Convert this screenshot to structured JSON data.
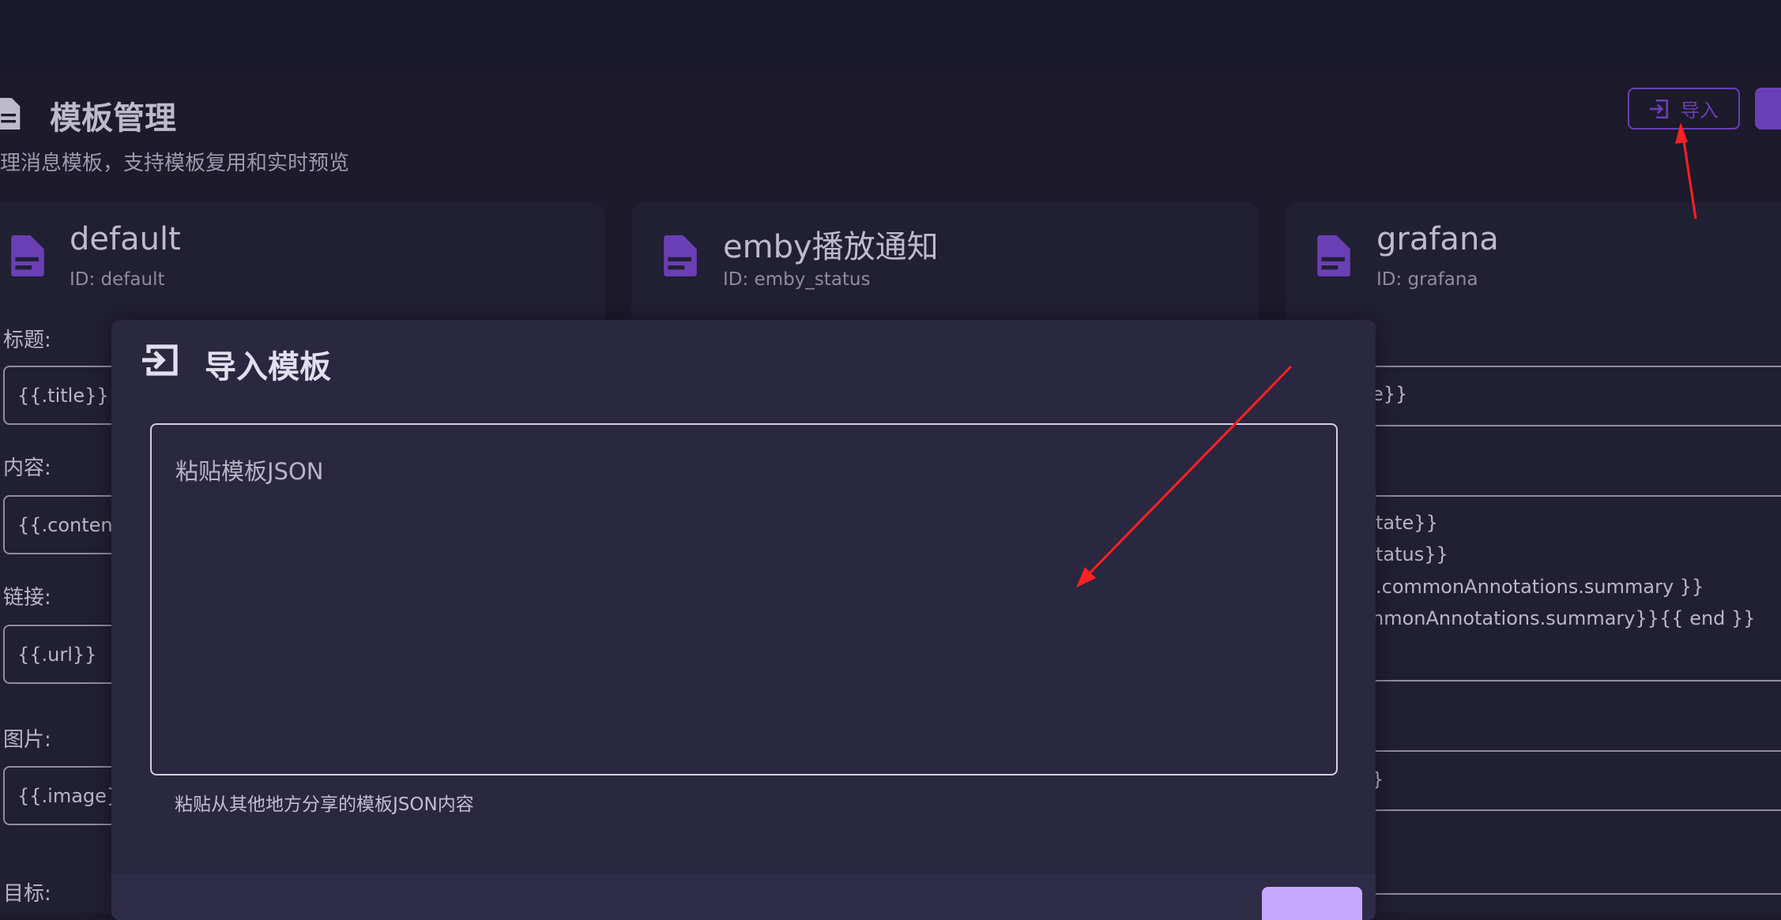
{
  "header": {
    "title": "模板管理",
    "subtitle": "理消息模板，支持模板复用和实时预览",
    "import_label": "导入"
  },
  "cards": [
    {
      "name": "default",
      "id": "ID: default",
      "fields": [
        {
          "label": "标题:",
          "value": "{{.title}}"
        },
        {
          "label": "内容:",
          "value": "{{.content}}"
        },
        {
          "label": "链接:",
          "value": "{{.url}}"
        },
        {
          "label": "图片:",
          "value": "{{.image}}"
        },
        {
          "label": "目标:"
        }
      ]
    },
    {
      "name": "emby播放通知",
      "id": "ID: emby_status"
    },
    {
      "name": "grafana",
      "id": "ID: grafana",
      "fragments": [
        "e}}",
        "tate}}",
        "tatus}}",
        ".commonAnnotations.summary }}",
        "nmonAnnotations.summary}}{{ end }}",
        "}"
      ]
    }
  ],
  "dialog": {
    "title": "导入模板",
    "placeholder": "粘贴模板JSON",
    "helper": "粘贴从其他地方分享的模板JSON内容"
  },
  "colors": {
    "accent": "#6a3fb5",
    "annotation": "#ff2020"
  }
}
